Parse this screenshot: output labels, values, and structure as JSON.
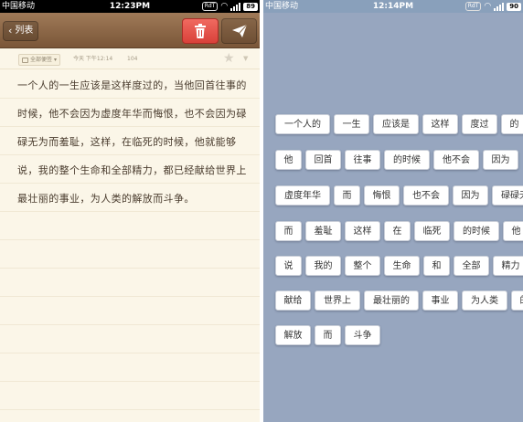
{
  "left": {
    "status": {
      "carrier": "中国移动",
      "time": "12:23PM",
      "pill": "RdT",
      "battery": "89"
    },
    "nav": {
      "back_label": "列表"
    },
    "meta": {
      "category": "全部便签",
      "date": "今天 下午12:14",
      "count": "104"
    },
    "lines": [
      "一个人的一生应该是这样度过的，当他回首往事的",
      "时候，他不会因为虚度年华而悔恨，也不会因为碌",
      "碌无为而羞耻，这样，在临死的时候，他就能够",
      "说，我的整个生命和全部精力，都已经献给世界上",
      "最壮丽的事业，为人类的解放而斗争。"
    ]
  },
  "right": {
    "status": {
      "carrier": "中国移动",
      "time": "12:14PM",
      "pill": "RdT",
      "battery": "90"
    },
    "rows": [
      [
        "一个人的",
        "一生",
        "应该是",
        "这样",
        "度过",
        "的",
        "当"
      ],
      [
        "他",
        "回首",
        "往事",
        "的时候",
        "他不会",
        "因为"
      ],
      [
        "虚度年华",
        "而",
        "悔恨",
        "也不会",
        "因为",
        "碌碌无为"
      ],
      [
        "而",
        "羞耻",
        "这样",
        "在",
        "临死",
        "的时候",
        "他",
        "就能够"
      ],
      [
        "说",
        "我的",
        "整个",
        "生命",
        "和",
        "全部",
        "精力",
        "都已经"
      ],
      [
        "献给",
        "世界上",
        "最壮丽的",
        "事业",
        "为人类",
        "的"
      ],
      [
        "解放",
        "而",
        "斗争"
      ]
    ]
  }
}
